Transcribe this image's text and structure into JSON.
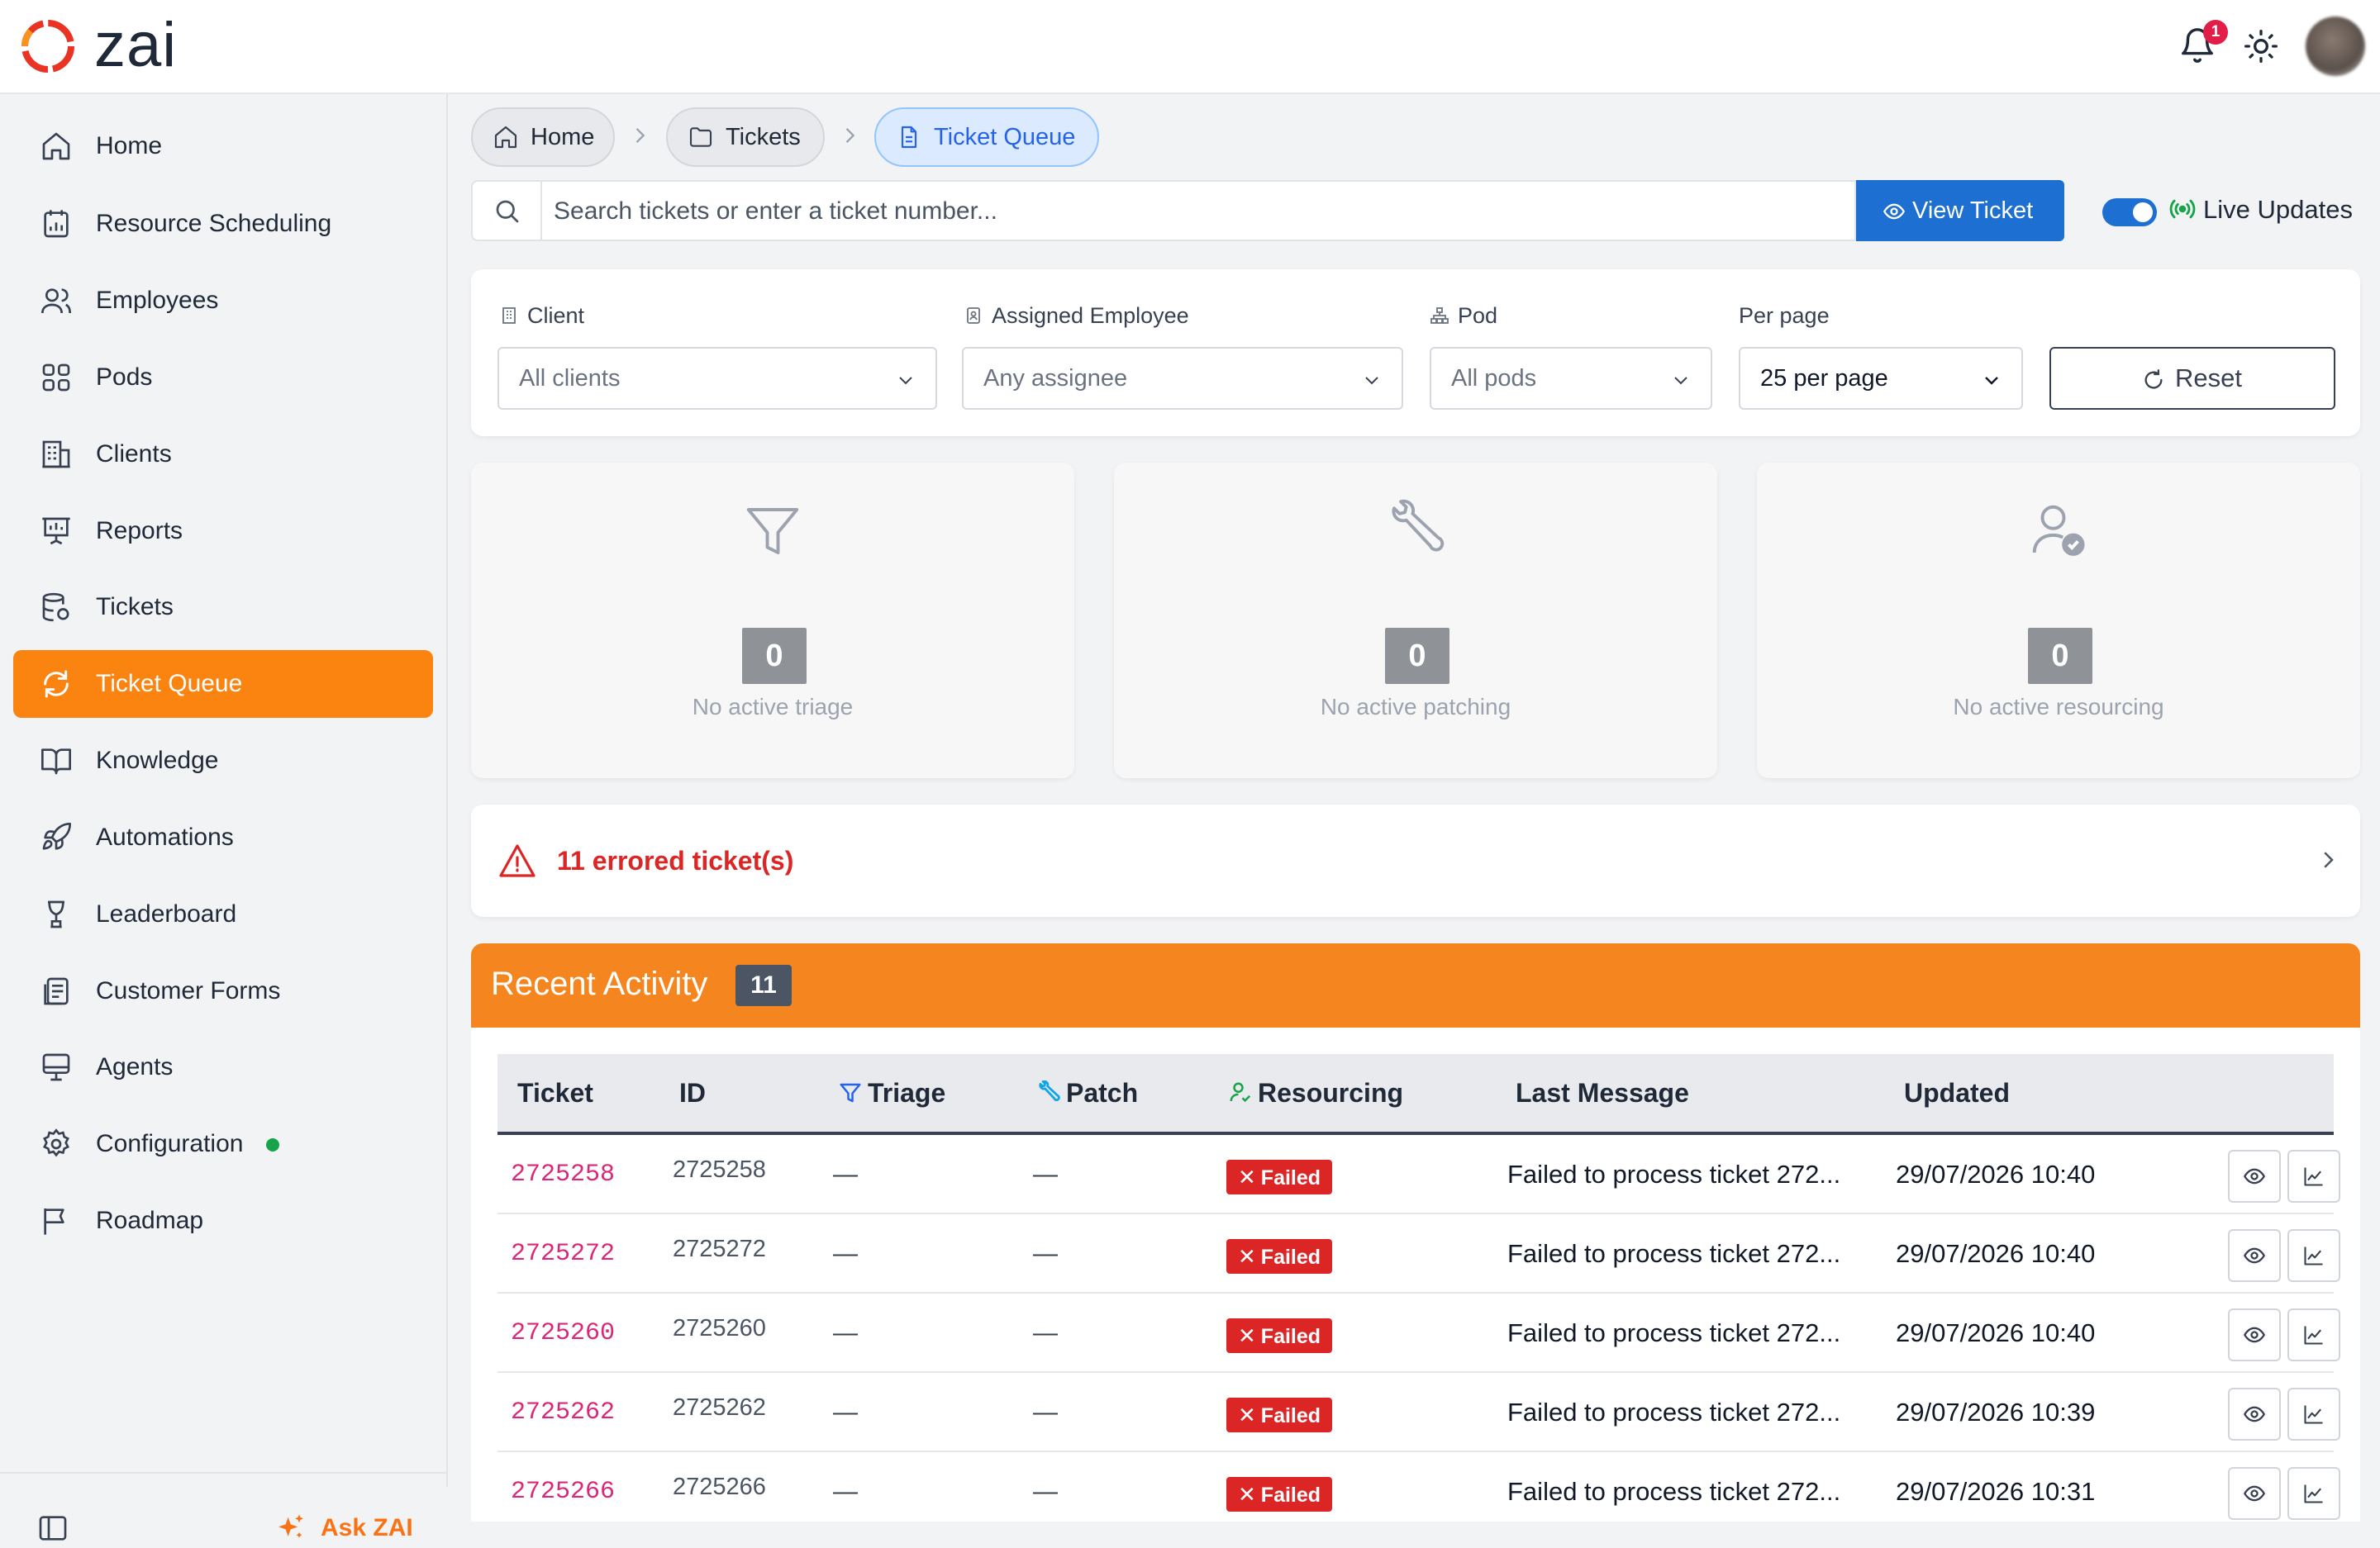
{
  "app": {
    "logo_text": "zai",
    "notification_count": "1"
  },
  "sidebar": {
    "items": [
      {
        "label": "Home",
        "icon": "home-icon"
      },
      {
        "label": "Resource Scheduling",
        "icon": "calendar-chart-icon"
      },
      {
        "label": "Employees",
        "icon": "users-icon"
      },
      {
        "label": "Pods",
        "icon": "grid-icon"
      },
      {
        "label": "Clients",
        "icon": "building-icon"
      },
      {
        "label": "Reports",
        "icon": "presentation-icon"
      },
      {
        "label": "Tickets",
        "icon": "ticket-icon"
      },
      {
        "label": "Ticket Queue",
        "icon": "refresh-icon",
        "active": true
      },
      {
        "label": "Knowledge",
        "icon": "book-icon"
      },
      {
        "label": "Automations",
        "icon": "rocket-icon"
      },
      {
        "label": "Leaderboard",
        "icon": "trophy-icon"
      },
      {
        "label": "Customer Forms",
        "icon": "forms-icon"
      },
      {
        "label": "Agents",
        "icon": "monitor-icon"
      },
      {
        "label": "Configuration",
        "icon": "gear-icon",
        "status": "online"
      },
      {
        "label": "Roadmap",
        "icon": "flag-icon"
      }
    ],
    "ask_label": "Ask ZAI"
  },
  "breadcrumb": {
    "home": "Home",
    "tickets": "Tickets",
    "current": "Ticket Queue"
  },
  "search": {
    "placeholder": "Search tickets or enter a ticket number...",
    "value": "",
    "button_label": "View Ticket"
  },
  "live_updates": {
    "label": "Live Updates",
    "enabled": true
  },
  "filters": {
    "client": {
      "label": "Client",
      "value": "All clients"
    },
    "assignee": {
      "label": "Assigned Employee",
      "value": "Any assignee"
    },
    "pod": {
      "label": "Pod",
      "value": "All pods"
    },
    "per_page": {
      "label": "Per page",
      "value": "25 per page"
    },
    "reset_label": "Reset"
  },
  "stats": {
    "triage": {
      "count": "0",
      "caption": "No active triage"
    },
    "patching": {
      "count": "0",
      "caption": "No active patching"
    },
    "resourcing": {
      "count": "0",
      "caption": "No active resourcing"
    }
  },
  "errors": {
    "text": "11 errored ticket(s)"
  },
  "activity": {
    "title": "Recent Activity",
    "count": "11",
    "columns": {
      "ticket": "Ticket",
      "id": "ID",
      "triage": "Triage",
      "patch": "Patch",
      "resourcing": "Resourcing",
      "last_message": "Last Message",
      "updated": "Updated"
    },
    "rows": [
      {
        "ticket": "2725258",
        "id": "2725258",
        "triage": "—",
        "patch": "—",
        "resourcing": "Failed",
        "last_message": "Failed to process ticket 272...",
        "updated": "29/07/2026 10:40"
      },
      {
        "ticket": "2725272",
        "id": "2725272",
        "triage": "—",
        "patch": "—",
        "resourcing": "Failed",
        "last_message": "Failed to process ticket 272...",
        "updated": "29/07/2026 10:40"
      },
      {
        "ticket": "2725260",
        "id": "2725260",
        "triage": "—",
        "patch": "—",
        "resourcing": "Failed",
        "last_message": "Failed to process ticket 272...",
        "updated": "29/07/2026 10:40"
      },
      {
        "ticket": "2725262",
        "id": "2725262",
        "triage": "—",
        "patch": "—",
        "resourcing": "Failed",
        "last_message": "Failed to process ticket 272...",
        "updated": "29/07/2026 10:39"
      },
      {
        "ticket": "2725266",
        "id": "2725266",
        "triage": "—",
        "patch": "—",
        "resourcing": "Failed",
        "last_message": "Failed to process ticket 272...",
        "updated": "29/07/2026 10:31"
      }
    ]
  },
  "colors": {
    "accent": "#fb830f",
    "primary": "#1d6fd1",
    "danger": "#dc2626",
    "ticket_link": "#db2777"
  }
}
